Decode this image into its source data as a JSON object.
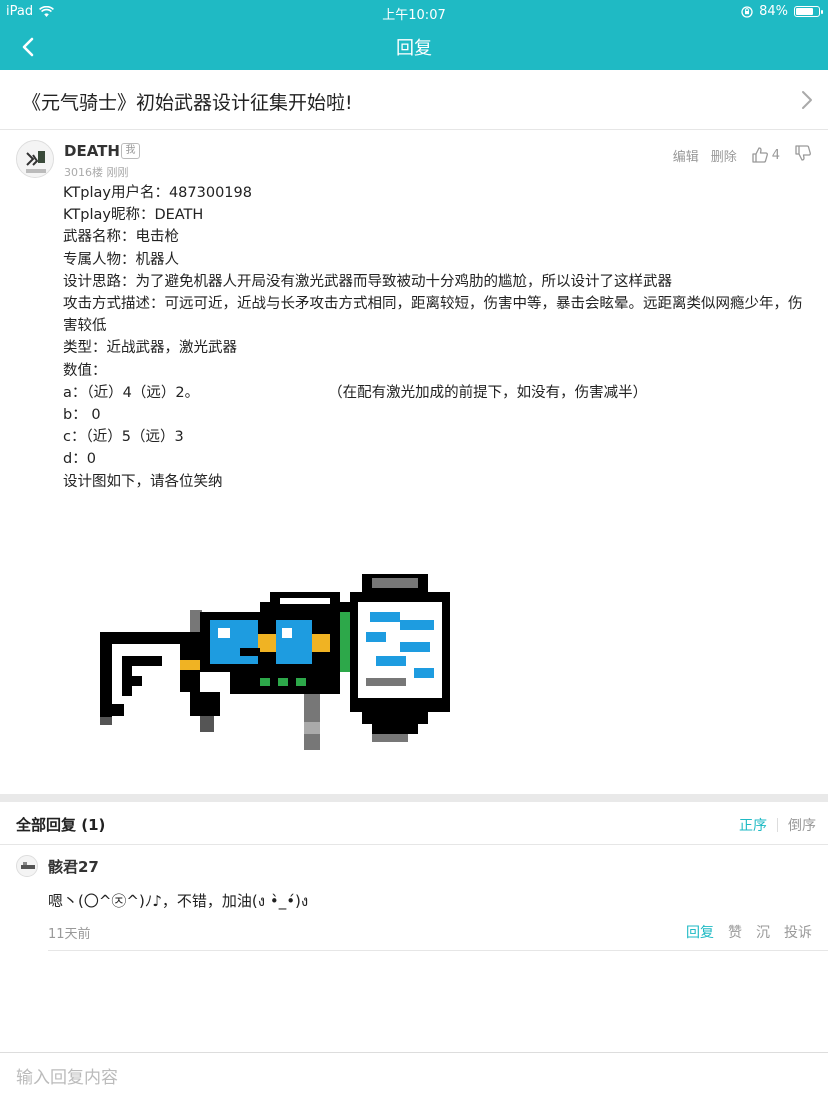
{
  "status_bar": {
    "carrier": "iPad",
    "time": "上午10:07",
    "battery": "84%",
    "battery_level": 0.84
  },
  "nav": {
    "title": "回复"
  },
  "topic": {
    "title": "《元气骑士》初始武器设计征集开始啦!"
  },
  "post": {
    "author": "DEATH",
    "me_badge": "我",
    "meta": "3016楼 刚刚",
    "edit_label": "编辑",
    "delete_label": "删除",
    "like_count": "4",
    "lines": [
      "KTplay用户名：487300198",
      "KTplay昵称：DEATH",
      "武器名称：电击枪",
      "专属人物：机器人",
      "设计思路：为了避免机器人开局没有激光武器而导致被动十分鸡肋的尴尬，所以设计了这样武器",
      "攻击方式描述：可远可近，近战与长矛攻击方式相同，距离较短，伤害中等，暴击会眩晕。远距离类似网瘾少年，伤害较低",
      "类型：近战武器，激光武器",
      "数值：",
      "a：（近）4（远）2。                            （在配有激光加成的前提下，如没有，伤害减半）",
      "b： 0",
      "c：（近）5（远）3",
      "d：0",
      "设计图如下，请各位笑纳"
    ]
  },
  "replies": {
    "header": "全部回复 (1)",
    "sort_asc": "正序",
    "sort_desc": "倒序",
    "items": [
      {
        "name": "骸君27",
        "text": "嗯丶(〇^㉨^)ﾉ♪，不错，加油(ง •̀_•́)ง",
        "time": "11天前",
        "reply_label": "回复",
        "like_label": "赞",
        "sink_label": "沉",
        "report_label": "投诉"
      }
    ]
  },
  "input": {
    "placeholder": "输入回复内容"
  },
  "colors": {
    "accent": "#1fbac4",
    "muted": "#999999",
    "divider": "#e6e6e6"
  },
  "icons": {
    "back": "chevron-left-icon",
    "topic_arrow": "chevron-right-icon",
    "like": "thumbs-up-icon",
    "dislike": "thumbs-down-icon",
    "wifi": "wifi-icon",
    "battery": "battery-icon"
  }
}
